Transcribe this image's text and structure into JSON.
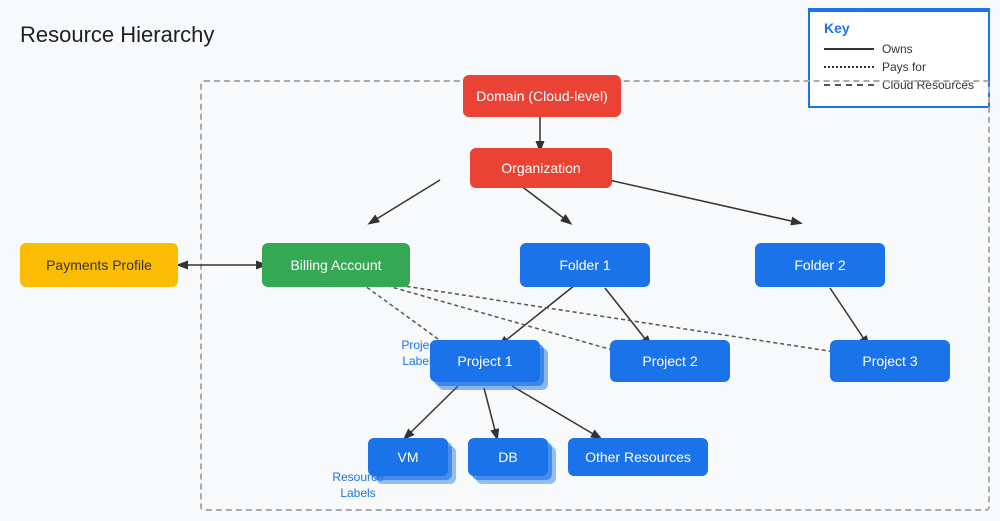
{
  "title": "Resource Hierarchy",
  "key": {
    "label": "Key",
    "items": [
      {
        "label": "Owns",
        "style": "solid"
      },
      {
        "label": "Pays for",
        "style": "dotted"
      },
      {
        "label": "Cloud Resources",
        "style": "dashed"
      }
    ]
  },
  "nodes": {
    "domain": "Domain (Cloud-level)",
    "organization": "Organization",
    "payments_profile": "Payments Profile",
    "billing_account": "Billing Account",
    "folder1": "Folder 1",
    "folder2": "Folder 2",
    "project1": "Project 1",
    "project2": "Project 2",
    "project3": "Project 3",
    "vm": "VM",
    "db": "DB",
    "other_resources": "Other Resources",
    "project_labels": "Project\nLabels",
    "resource_labels": "Resource\nLabels"
  }
}
